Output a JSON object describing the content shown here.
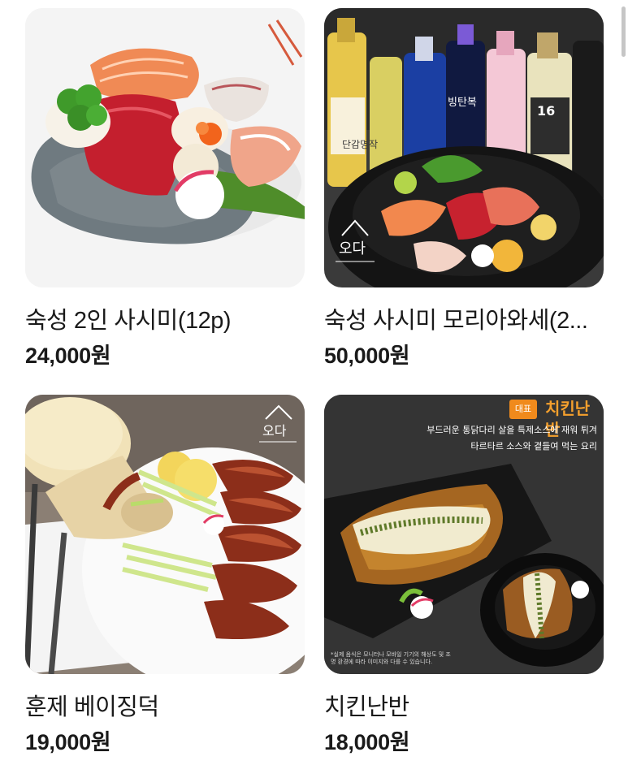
{
  "products": [
    {
      "name": "숙성 2인 사시미(12p)",
      "price": "24,000원"
    },
    {
      "name": "숙성 사시미 모리아와세(2...",
      "price": "50,000원",
      "image_text": {
        "logo": "오다",
        "bottle_label_1": "단감명작",
        "bottle_label_2": "빙탄복",
        "bottle_label_3": "16"
      }
    },
    {
      "name": "훈제 베이징덕",
      "price": "19,000원",
      "image_text": {
        "logo": "오다"
      }
    },
    {
      "name": "치킨난반",
      "price": "18,000원",
      "image_text": {
        "tag": "대표",
        "caption": "치킨난반",
        "desc_line_1": "부드러운 통닭다리 살을 특제소스에 재워 튀겨",
        "desc_line_2": "타르타르 소스와 곁들여 먹는 요리",
        "disclaimer": "*실제 음식은 모니터나 모바일 기기의 해상도 및 조명 환경에 따라 이미지와 다를 수 있습니다."
      }
    }
  ]
}
